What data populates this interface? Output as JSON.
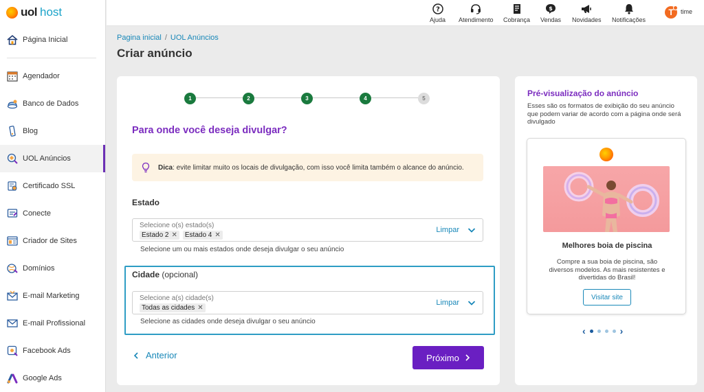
{
  "brand": {
    "uol": "uol",
    "host": "host"
  },
  "sidebar": {
    "items": [
      {
        "label": "Página Inicial",
        "icon": "home-icon"
      },
      {
        "label": "Agendador",
        "icon": "calendar-icon"
      },
      {
        "label": "Banco de Dados",
        "icon": "database-icon"
      },
      {
        "label": "Blog",
        "icon": "blog-icon"
      },
      {
        "label": "UOL Anúncios",
        "icon": "ads-icon",
        "active": true
      },
      {
        "label": "Certificado SSL",
        "icon": "certificate-icon"
      },
      {
        "label": "Conecte",
        "icon": "connect-icon"
      },
      {
        "label": "Criador de Sites",
        "icon": "site-builder-icon"
      },
      {
        "label": "Domínios",
        "icon": "domain-icon"
      },
      {
        "label": "E-mail Marketing",
        "icon": "email-marketing-icon"
      },
      {
        "label": "E-mail Profissional",
        "icon": "email-icon"
      },
      {
        "label": "Facebook Ads",
        "icon": "facebook-ads-icon"
      },
      {
        "label": "Google Ads",
        "icon": "google-ads-icon"
      }
    ]
  },
  "topbar": {
    "items": [
      {
        "label": "Ajuda",
        "icon": "help-icon"
      },
      {
        "label": "Atendimento",
        "icon": "headset-icon"
      },
      {
        "label": "Cobrança",
        "icon": "billing-icon"
      },
      {
        "label": "Vendas",
        "icon": "sales-icon"
      },
      {
        "label": "Novidades",
        "icon": "megaphone-icon"
      },
      {
        "label": "Notificações",
        "icon": "bell-icon"
      }
    ],
    "user_initial": "T",
    "user_name": "time"
  },
  "breadcrumb": {
    "home": "Pagina inicial",
    "separator": "/",
    "current": "UOL Anúncios"
  },
  "page_title": "Criar anúncio",
  "steps": {
    "labels": [
      "1",
      "2",
      "3",
      "4",
      "5"
    ],
    "completed": 4
  },
  "form": {
    "question": "Para onde você deseja divulgar?",
    "tip_bold": "Dica",
    "tip_text": ": evite limitar muito os locais de divulgação, com isso você limita também o alcance do anúncio.",
    "state": {
      "label": "Estado",
      "placeholder": "Selecione o(s) estado(s)",
      "chips": [
        "Estado 2",
        "Estado 4"
      ],
      "clear": "Limpar",
      "helper": "Selecione um ou mais estados onde deseja divulgar o seu anúncio"
    },
    "city": {
      "label": "Cidade",
      "optional": "(opcional)",
      "placeholder": "Selecione a(s) cidade(s)",
      "chips": [
        "Todas as cidades"
      ],
      "clear": "Limpar",
      "helper": "Selecione as cidades onde deseja divulgar o seu anúncio"
    },
    "back_label": "Anterior",
    "next_label": "Próximo"
  },
  "preview": {
    "title": "Pré-visualização do anúncio",
    "description": "Esses são os formatos de exibição do seu anúncio que podem variar de acordo com a página onde será divulgado",
    "ad_name": "Melhores boia de piscina",
    "ad_description": "Compre a sua boia de piscina, são diversos modelos. As mais resistentes e divertidas do Brasil!",
    "ad_button": "Visitar site",
    "carousel": {
      "count": 4,
      "active": 0
    }
  },
  "colors": {
    "accent_purple": "#6a1fc2",
    "link_blue": "#1787b8",
    "step_green": "#1a7a3e",
    "tip_bg": "#fdf3e3",
    "focus_border": "#2d9cc4"
  }
}
